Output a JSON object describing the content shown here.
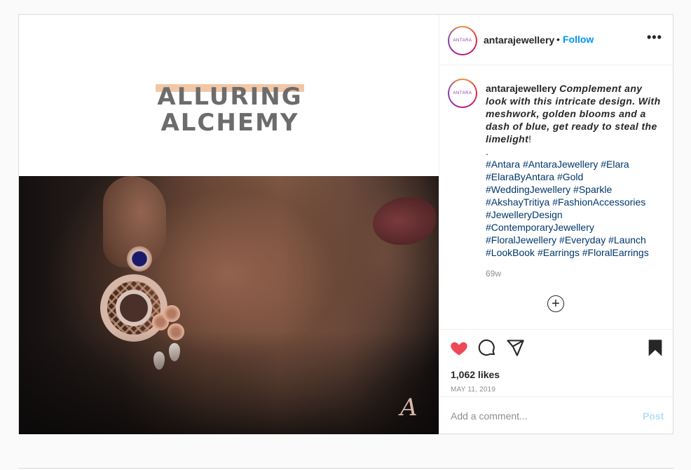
{
  "media": {
    "headline_line1": "ALLURING",
    "headline_line2": "ALCHEMY",
    "monogram": "A"
  },
  "header": {
    "avatar_text": "ANTARA",
    "username": "antarajewellery",
    "separator": "•",
    "follow_label": "Follow",
    "more_label": "•••"
  },
  "caption": {
    "avatar_text": "ANTARA",
    "username": "antarajewellery",
    "text": "Complement any look with this intricate design. With meshwork, golden blooms and a dash of blue, get ready to steal the limelight",
    "exclaim": "!",
    "dot": ".",
    "hashtags": [
      "#Antara",
      "#AntaraJewellery",
      "#Elara",
      "#ElaraByAntara",
      "#Gold",
      "#WeddingJewellery",
      "#Sparkle",
      "#AkshayTritiya",
      "#FashionAccessories",
      "#JewelleryDesign",
      "#ContemporaryJewellery",
      "#FloralJewellery",
      "#Everyday",
      "#Launch",
      "#LookBook",
      "#Earrings",
      "#FloralEarrings"
    ],
    "age": "69w",
    "load_more": "+"
  },
  "actions": {
    "likes": "1,062 likes",
    "date": "MAY 11, 2019",
    "heart_color": "#ed4956"
  },
  "comment": {
    "placeholder": "Add a comment...",
    "post_label": "Post"
  }
}
